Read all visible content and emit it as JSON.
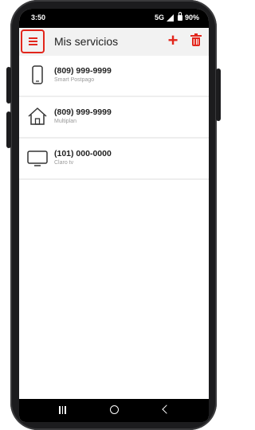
{
  "status_bar": {
    "time": "3:50",
    "network": "5G",
    "battery": "90%"
  },
  "app_bar": {
    "title": "Mis servicios",
    "add_symbol": "+"
  },
  "services": [
    {
      "number": "(809) 999-9999",
      "plan": "Smart Postpago",
      "icon": "mobile-phone-icon"
    },
    {
      "number": "(809) 999-9999",
      "plan": "Multiplan",
      "icon": "house-icon"
    },
    {
      "number": "(101) 000-0000",
      "plan": "Claro tv",
      "icon": "tv-icon"
    }
  ],
  "colors": {
    "accent": "#e2261c",
    "app_bar_bg": "#f2f2f2",
    "secondary_text": "#9a9a9a"
  }
}
